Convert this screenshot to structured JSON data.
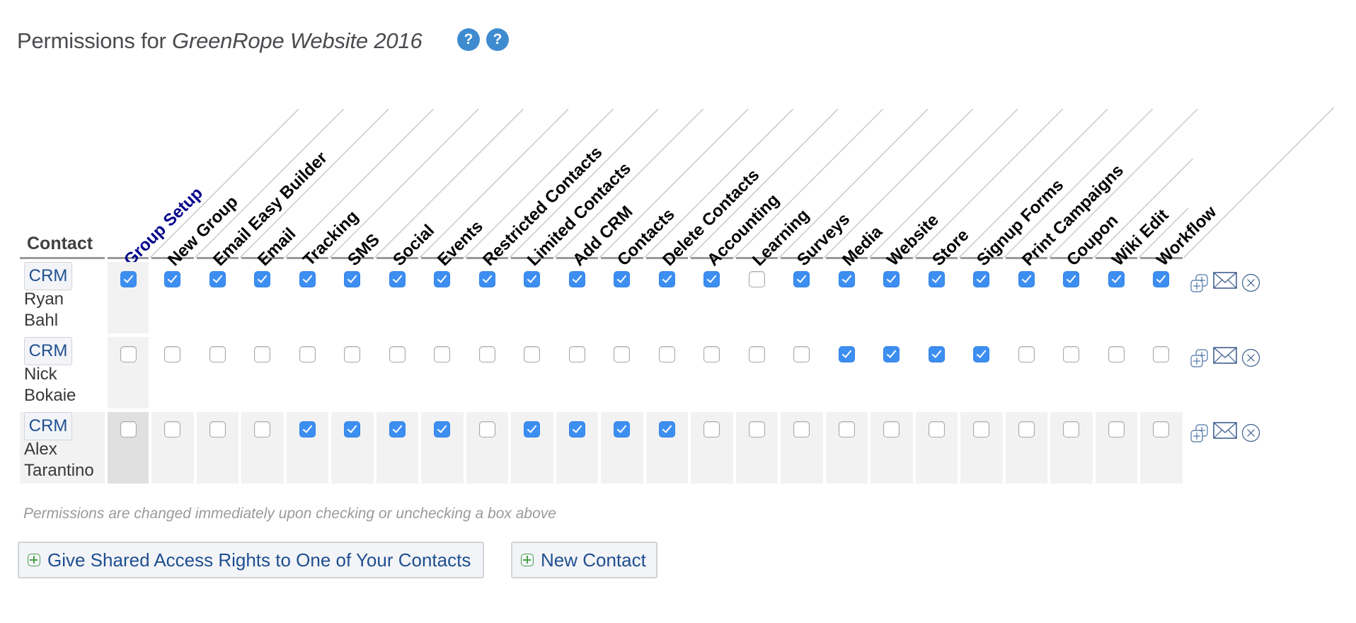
{
  "header": {
    "title_prefix": "Permissions for ",
    "title_group": "GreenRope Website 2016",
    "help_icons": [
      "help-icon",
      "help-icon"
    ],
    "help_glyph": "?"
  },
  "table": {
    "contact_header": "Contact",
    "columns": [
      "Group Setup",
      "New Group",
      "Email Easy Builder",
      "Email",
      "Tracking",
      "SMS",
      "Social",
      "Events",
      "Restricted Contacts",
      "Limited Contacts",
      "Add CRM",
      "Contacts",
      "Delete Contacts",
      "Accounting",
      "Learning",
      "Surveys",
      "Media",
      "Website",
      "Store",
      "Signup Forms",
      "Print Campaigns",
      "Coupon",
      "Wiki Edit",
      "Workflow"
    ],
    "rows": [
      {
        "crm_label": "CRM",
        "first_name": "Ryan",
        "last_name": "Bahl",
        "permissions": [
          true,
          true,
          true,
          true,
          true,
          true,
          true,
          true,
          true,
          true,
          true,
          true,
          true,
          true,
          false,
          true,
          true,
          true,
          true,
          true,
          true,
          true,
          true,
          true
        ]
      },
      {
        "crm_label": "CRM",
        "first_name": "Nick",
        "last_name": "Bokaie",
        "permissions": [
          false,
          false,
          false,
          false,
          false,
          false,
          false,
          false,
          false,
          false,
          false,
          false,
          false,
          false,
          false,
          false,
          true,
          true,
          true,
          true,
          false,
          false,
          false,
          false
        ]
      },
      {
        "crm_label": "CRM",
        "first_name": "Alex",
        "last_name": "Tarantino",
        "permissions": [
          false,
          false,
          false,
          false,
          true,
          true,
          true,
          true,
          false,
          true,
          true,
          true,
          true,
          false,
          false,
          false,
          false,
          false,
          false,
          false,
          false,
          false,
          false,
          false
        ]
      }
    ],
    "row_actions": [
      "duplicate-add-icon",
      "email-icon",
      "remove-icon"
    ]
  },
  "footer": {
    "note": "Permissions are changed immediately upon checking or unchecking a box above",
    "give_access_button": "Give Shared Access Rights to One of Your Contacts",
    "new_contact_button": "New Contact"
  },
  "colors": {
    "checkbox_checked": "#3d8ef1",
    "link_blue": "#1e4f8f",
    "group_setup_label": "#00008b",
    "help_icon": "#3f8bd0",
    "plus_green": "#4aa04a"
  }
}
